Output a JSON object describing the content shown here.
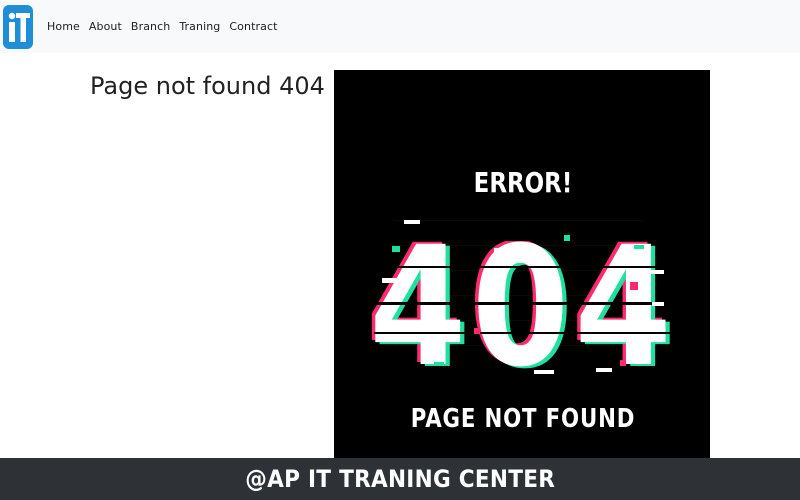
{
  "navbar": {
    "logo_text": "iT",
    "links": [
      {
        "label": "Home"
      },
      {
        "label": "About"
      },
      {
        "label": "Branch"
      },
      {
        "label": "Traning"
      },
      {
        "label": "Contract"
      }
    ]
  },
  "main": {
    "title": "Page not found 404"
  },
  "error_image": {
    "heading": "ERROR!",
    "code": "404",
    "caption": "PAGE NOT FOUND"
  },
  "footer": {
    "text": "@AP IT TRANING CENTER"
  },
  "colors": {
    "navbar_bg": "#f8f9fa",
    "logo_blue": "#1e8fd6",
    "footer_bg": "#2e3236",
    "glitch_pink": "#ff2a6d",
    "glitch_green": "#1fe0a0"
  }
}
